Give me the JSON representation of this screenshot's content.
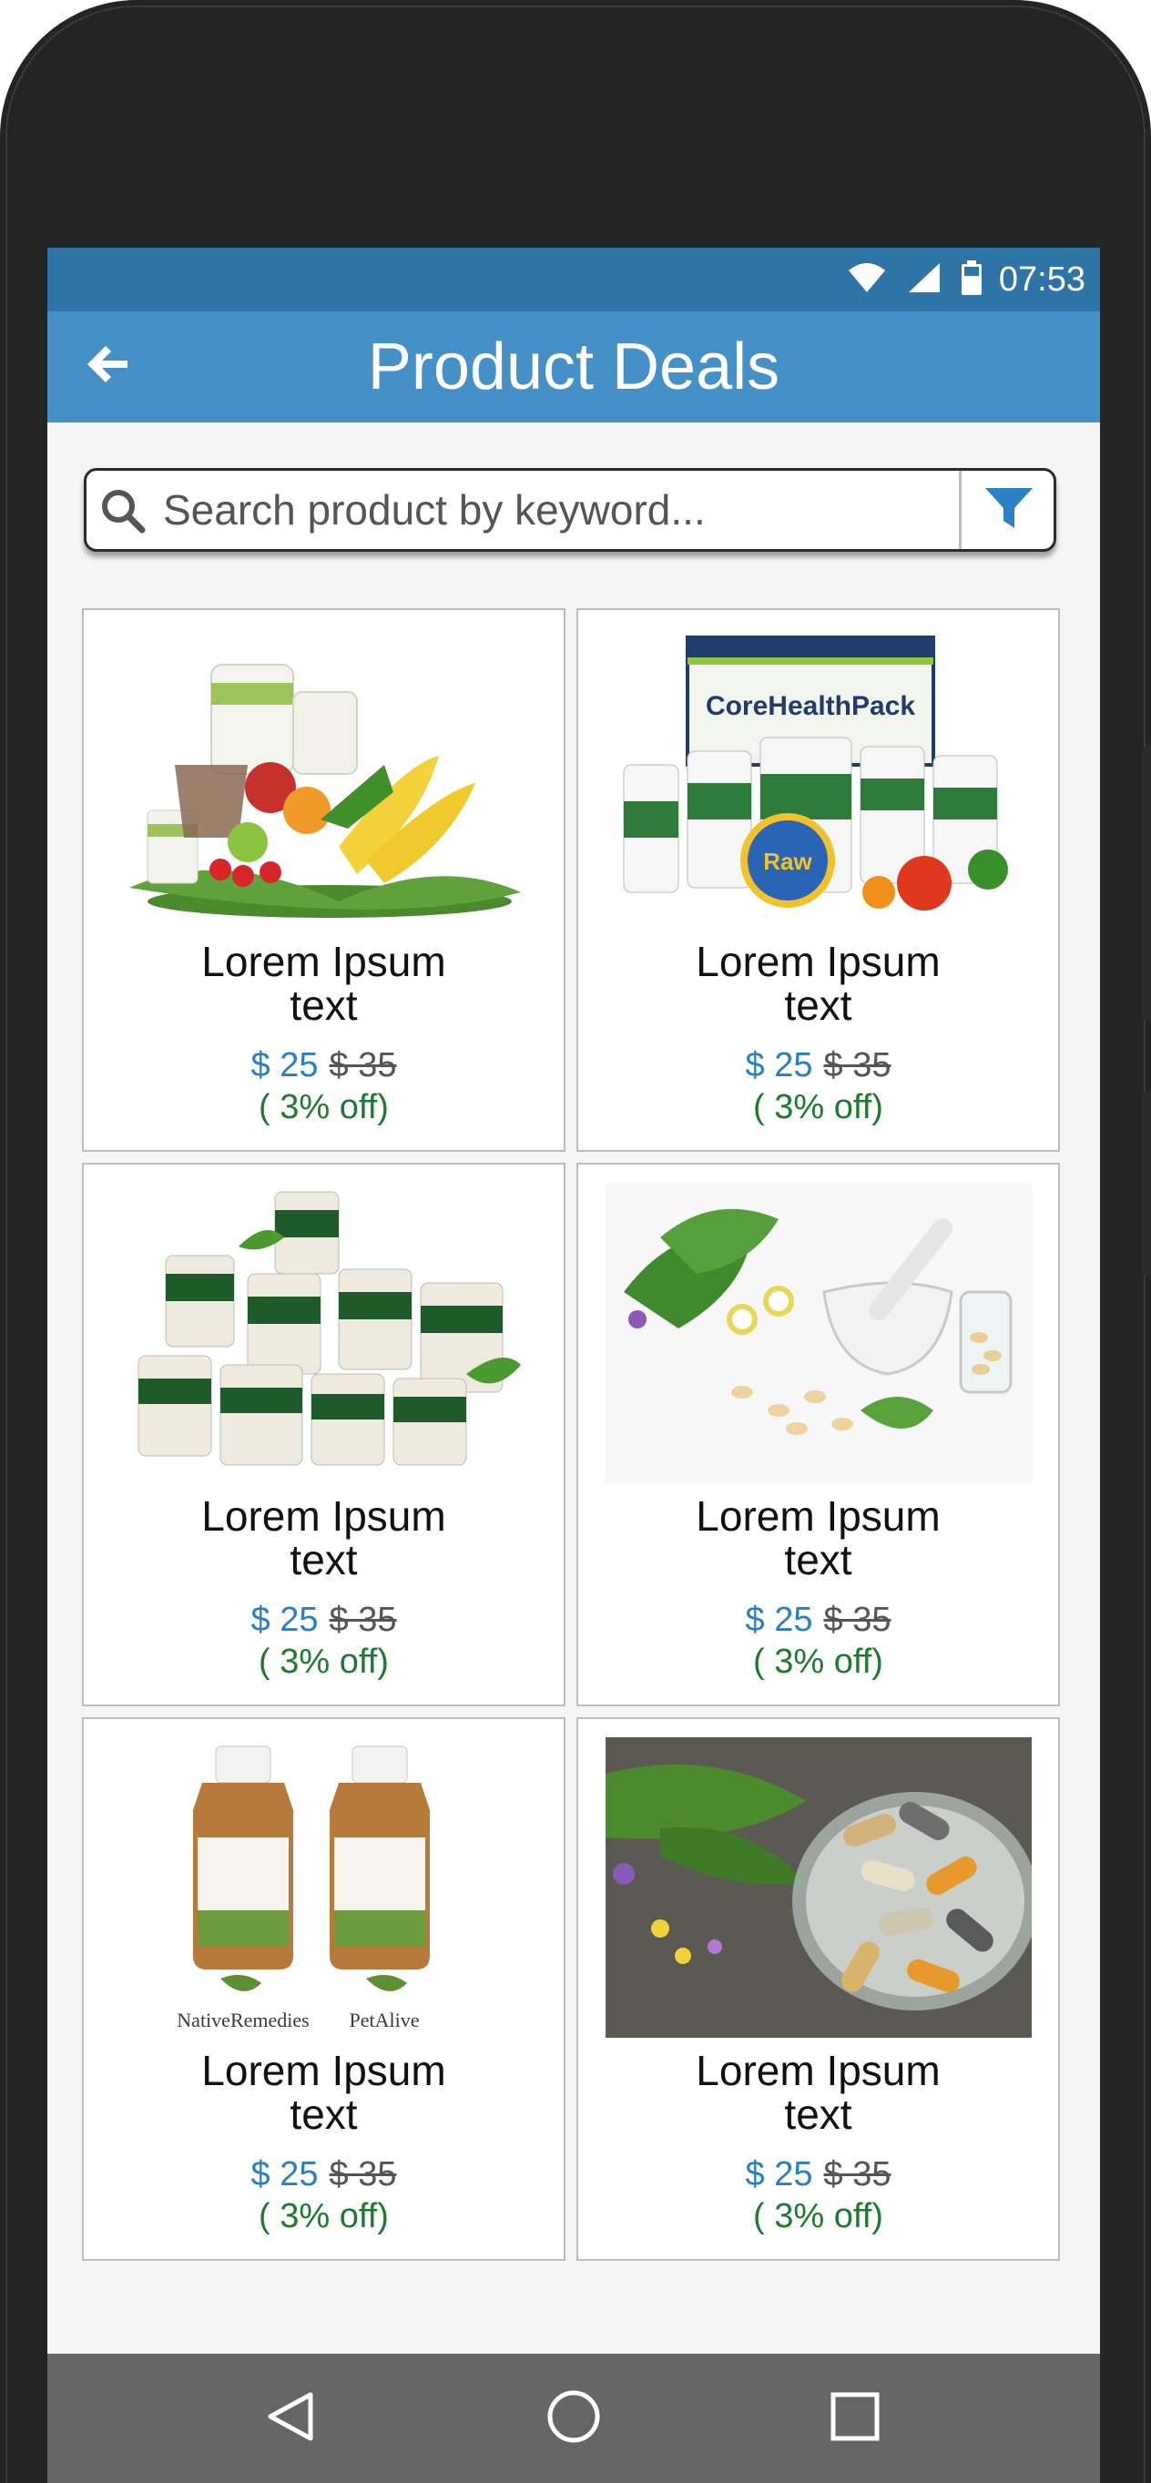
{
  "status_bar": {
    "time": "07:53",
    "icons": [
      "wifi-icon",
      "signal-icon",
      "battery-icon"
    ]
  },
  "app_bar": {
    "title": "Product Deals",
    "back_icon": "arrow-left-icon"
  },
  "search": {
    "placeholder": "Search product by keyword...",
    "value": "",
    "search_icon": "search-icon",
    "filter_icon": "filter-icon"
  },
  "products": [
    {
      "name": "Lorem Ipsum text",
      "price": "$ 25",
      "old_price": "$ 35",
      "discount": "( 3% off)",
      "image": "fruits-and-supplement-containers"
    },
    {
      "name": "Lorem Ipsum text",
      "price": "$ 25",
      "old_price": "$ 35",
      "discount": "( 3% off)",
      "image": "core-health-pack-bottles"
    },
    {
      "name": "Lorem Ipsum text",
      "price": "$ 25",
      "old_price": "$ 35",
      "discount": "( 3% off)",
      "image": "herbal-supplement-bottles"
    },
    {
      "name": "Lorem Ipsum text",
      "price": "$ 25",
      "old_price": "$ 35",
      "discount": "( 3% off)",
      "image": "mortar-pestle-herbs-capsules"
    },
    {
      "name": "Lorem Ipsum text",
      "price": "$ 25",
      "old_price": "$ 35",
      "discount": "( 3% off)",
      "image": "remedy-bottles",
      "logo_text": [
        "NativeRemedies",
        "PetAlive"
      ]
    },
    {
      "name": "Lorem Ipsum text",
      "price": "$ 25",
      "old_price": "$ 35",
      "discount": "( 3% off)",
      "image": "capsules-bowl-flowers"
    }
  ],
  "nav_bar": {
    "icons": [
      "back-triangle-icon",
      "home-circle-icon",
      "recents-square-icon"
    ]
  },
  "colors": {
    "status_bar": "#2e74a6",
    "app_bar": "#4590c7",
    "price": "#2a7ec2",
    "discount": "#1f7a2e",
    "nav_bar": "#666666"
  }
}
